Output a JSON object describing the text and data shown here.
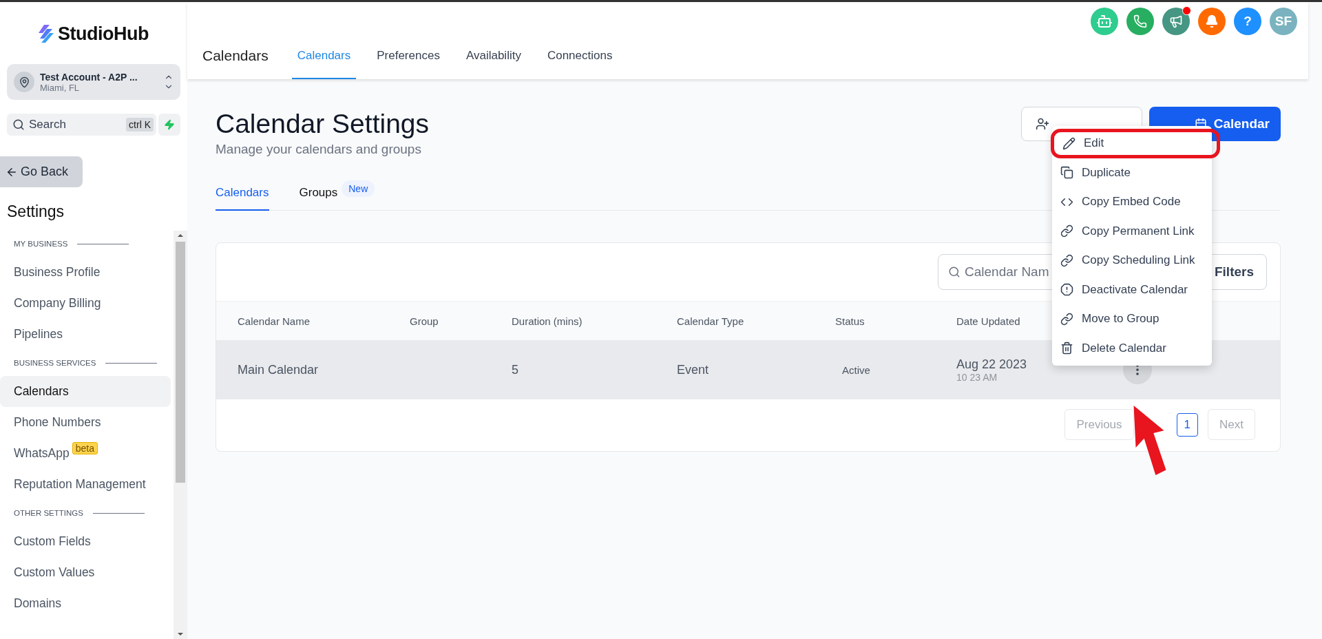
{
  "sidebar": {
    "logo": "StudioHub",
    "account": {
      "name": "Test Account - A2P ...",
      "location": "Miami, FL"
    },
    "search": {
      "placeholder": "Search",
      "shortcut": "ctrl K"
    },
    "back": "Go Back",
    "title": "Settings",
    "nav": [
      {
        "kind": "heading",
        "label": "MY BUSINESS"
      },
      {
        "kind": "item",
        "label": "Business Profile",
        "selected": false
      },
      {
        "kind": "item",
        "label": "Company Billing",
        "selected": false
      },
      {
        "kind": "item",
        "label": "Pipelines",
        "selected": false
      },
      {
        "kind": "heading",
        "label": "BUSINESS SERVICES"
      },
      {
        "kind": "item",
        "label": "Calendars",
        "selected": true
      },
      {
        "kind": "item",
        "label": "Phone Numbers",
        "selected": false
      },
      {
        "kind": "item",
        "label": "WhatsApp",
        "selected": false,
        "badge": "beta"
      },
      {
        "kind": "item",
        "label": "Reputation Management",
        "selected": false
      },
      {
        "kind": "heading",
        "label": "OTHER SETTINGS"
      },
      {
        "kind": "item",
        "label": "Custom Fields",
        "selected": false
      },
      {
        "kind": "item",
        "label": "Custom Values",
        "selected": false
      },
      {
        "kind": "item",
        "label": "Domains",
        "selected": false
      }
    ]
  },
  "header": {
    "title": "Calendars",
    "tabs": [
      {
        "label": "Calendars",
        "selected": true
      },
      {
        "label": "Preferences",
        "selected": false
      },
      {
        "label": "Availability",
        "selected": false
      },
      {
        "label": "Connections",
        "selected": false
      }
    ],
    "announcements_unread": true,
    "help": "?",
    "avatar": "SF"
  },
  "page": {
    "title": "Calendar Settings",
    "subtitle": "Manage your calendars and groups",
    "primary_button": "Calendar",
    "tabs": [
      {
        "label": "Calendars",
        "selected": true
      },
      {
        "label": "Groups",
        "selected": false,
        "badge": "New"
      }
    ],
    "search": {
      "placeholder": "Calendar Nam"
    },
    "filters": "Filters",
    "columns": [
      "Calendar Name",
      "Group",
      "Duration (mins)",
      "Calendar Type",
      "Status",
      "Date Updated"
    ],
    "rows": [
      {
        "name": "Main Calendar",
        "duration": "5",
        "type": "Event",
        "status": "Active",
        "date": "Aug 22 2023",
        "time": "10 23 AM"
      }
    ],
    "pagination": {
      "previous": "Previous",
      "page": "1",
      "next": "Next"
    }
  },
  "menu": [
    {
      "kind": "edit",
      "label": "Edit",
      "highlighted": true
    },
    {
      "kind": "duplicate",
      "label": "Duplicate",
      "highlighted": false
    },
    {
      "kind": "embed",
      "label": "Copy Embed Code",
      "highlighted": false
    },
    {
      "kind": "link",
      "label": "Copy Permanent Link",
      "highlighted": false
    },
    {
      "kind": "link",
      "label": "Copy Scheduling Link",
      "highlighted": false
    },
    {
      "kind": "deactivate",
      "label": "Deactivate Calendar",
      "highlighted": false
    },
    {
      "kind": "link",
      "label": "Move to Group",
      "highlighted": false
    },
    {
      "kind": "delete",
      "label": "Delete Calendar",
      "highlighted": false
    }
  ]
}
